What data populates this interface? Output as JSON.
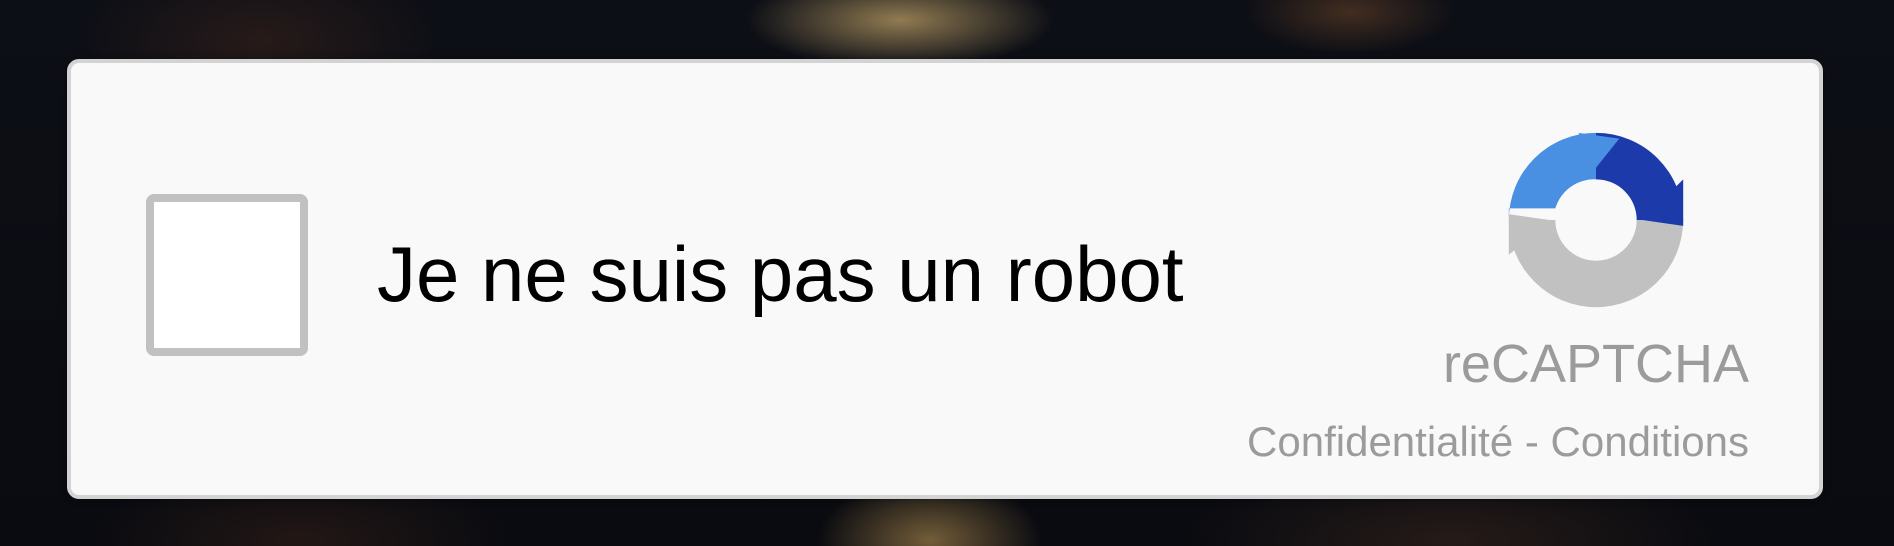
{
  "widget": {
    "checkbox_label": "Je ne suis pas un robot",
    "checked": false,
    "brand": "reCAPTCHA",
    "privacy_link": "Confidentialité",
    "separator": " - ",
    "terms_link": "Conditions",
    "logo_icon": "recaptcha-logo-icon"
  },
  "colors": {
    "text_gray": "#9b9b9b",
    "logo_blue_light": "#4a90e2",
    "logo_blue_dark": "#1c3aa9",
    "logo_gray": "#c1c1c1",
    "box_background": "#f9f9f9"
  }
}
